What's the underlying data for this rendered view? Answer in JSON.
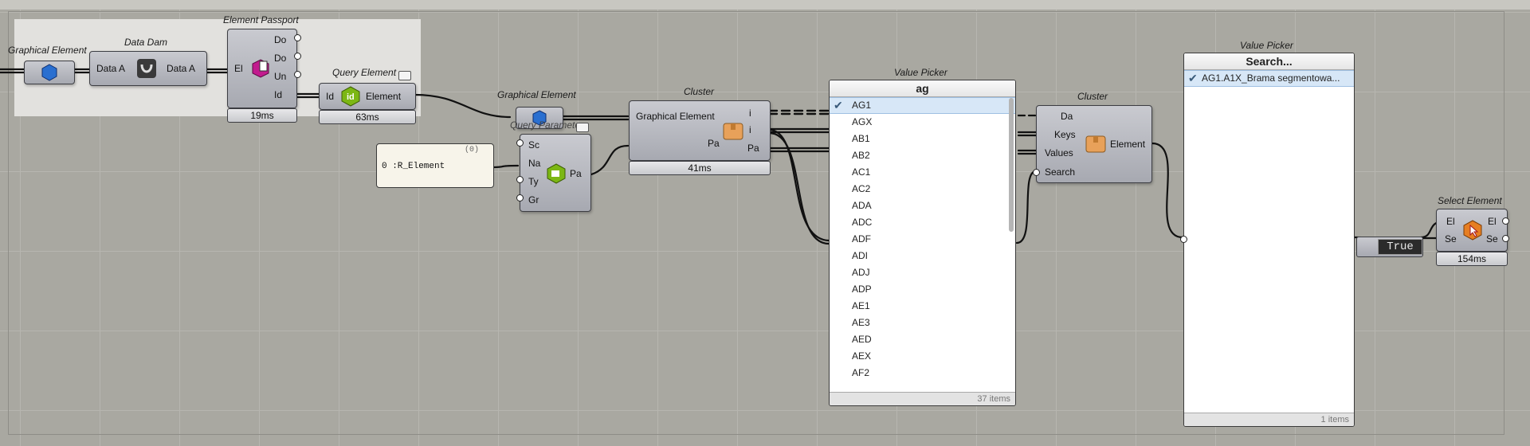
{
  "graphical_element_1": {
    "title": "Graphical Element"
  },
  "data_dam": {
    "title": "Data Dam",
    "input": "Data A",
    "output": "Data A"
  },
  "element_passport": {
    "title": "Element Passport",
    "input": "El",
    "outputs": [
      "Do",
      "Do",
      "Un",
      "Id"
    ],
    "time": "19ms"
  },
  "query_element": {
    "title": "Query Element",
    "input": "Id",
    "output": "Element",
    "time": "63ms"
  },
  "graphical_element_2": {
    "title": "Graphical Element"
  },
  "query_parameters": {
    "title": "Query Parameters",
    "inputs": [
      "Sc",
      "Na",
      "Ty",
      "Gr"
    ],
    "output": "Pa"
  },
  "panel": {
    "count": "(0)",
    "text": "0 :R_Element"
  },
  "cluster_1": {
    "title": "Cluster",
    "input_1": "Graphical Element",
    "input_2": "Pa",
    "outputs": [
      "i",
      "i",
      "Pa"
    ],
    "time": "41ms"
  },
  "value_picker_1": {
    "title": "Value Picker",
    "header": "ag",
    "selected": "AG1",
    "items": [
      "AG1",
      "AGX",
      "AB1",
      "AB2",
      "AC1",
      "AC2",
      "ADA",
      "ADC",
      "ADF",
      "ADI",
      "ADJ",
      "ADP",
      "AE1",
      "AE3",
      "AED",
      "AEX",
      "AF2"
    ],
    "count": "37 items"
  },
  "cluster_2": {
    "title": "Cluster",
    "inputs": [
      "Da",
      "Keys",
      "Values",
      "Search"
    ],
    "output": "Element"
  },
  "value_picker_2": {
    "title": "Value Picker",
    "header": "Search...",
    "items": [
      "AG1.A1X_Brama segmentowa..."
    ],
    "count": "1 items"
  },
  "toggle": {
    "value": "True"
  },
  "select_element": {
    "title": "Select Element",
    "inputs": [
      "El",
      "Se"
    ],
    "outputs": [
      "El",
      "Se"
    ],
    "time": "154ms"
  }
}
